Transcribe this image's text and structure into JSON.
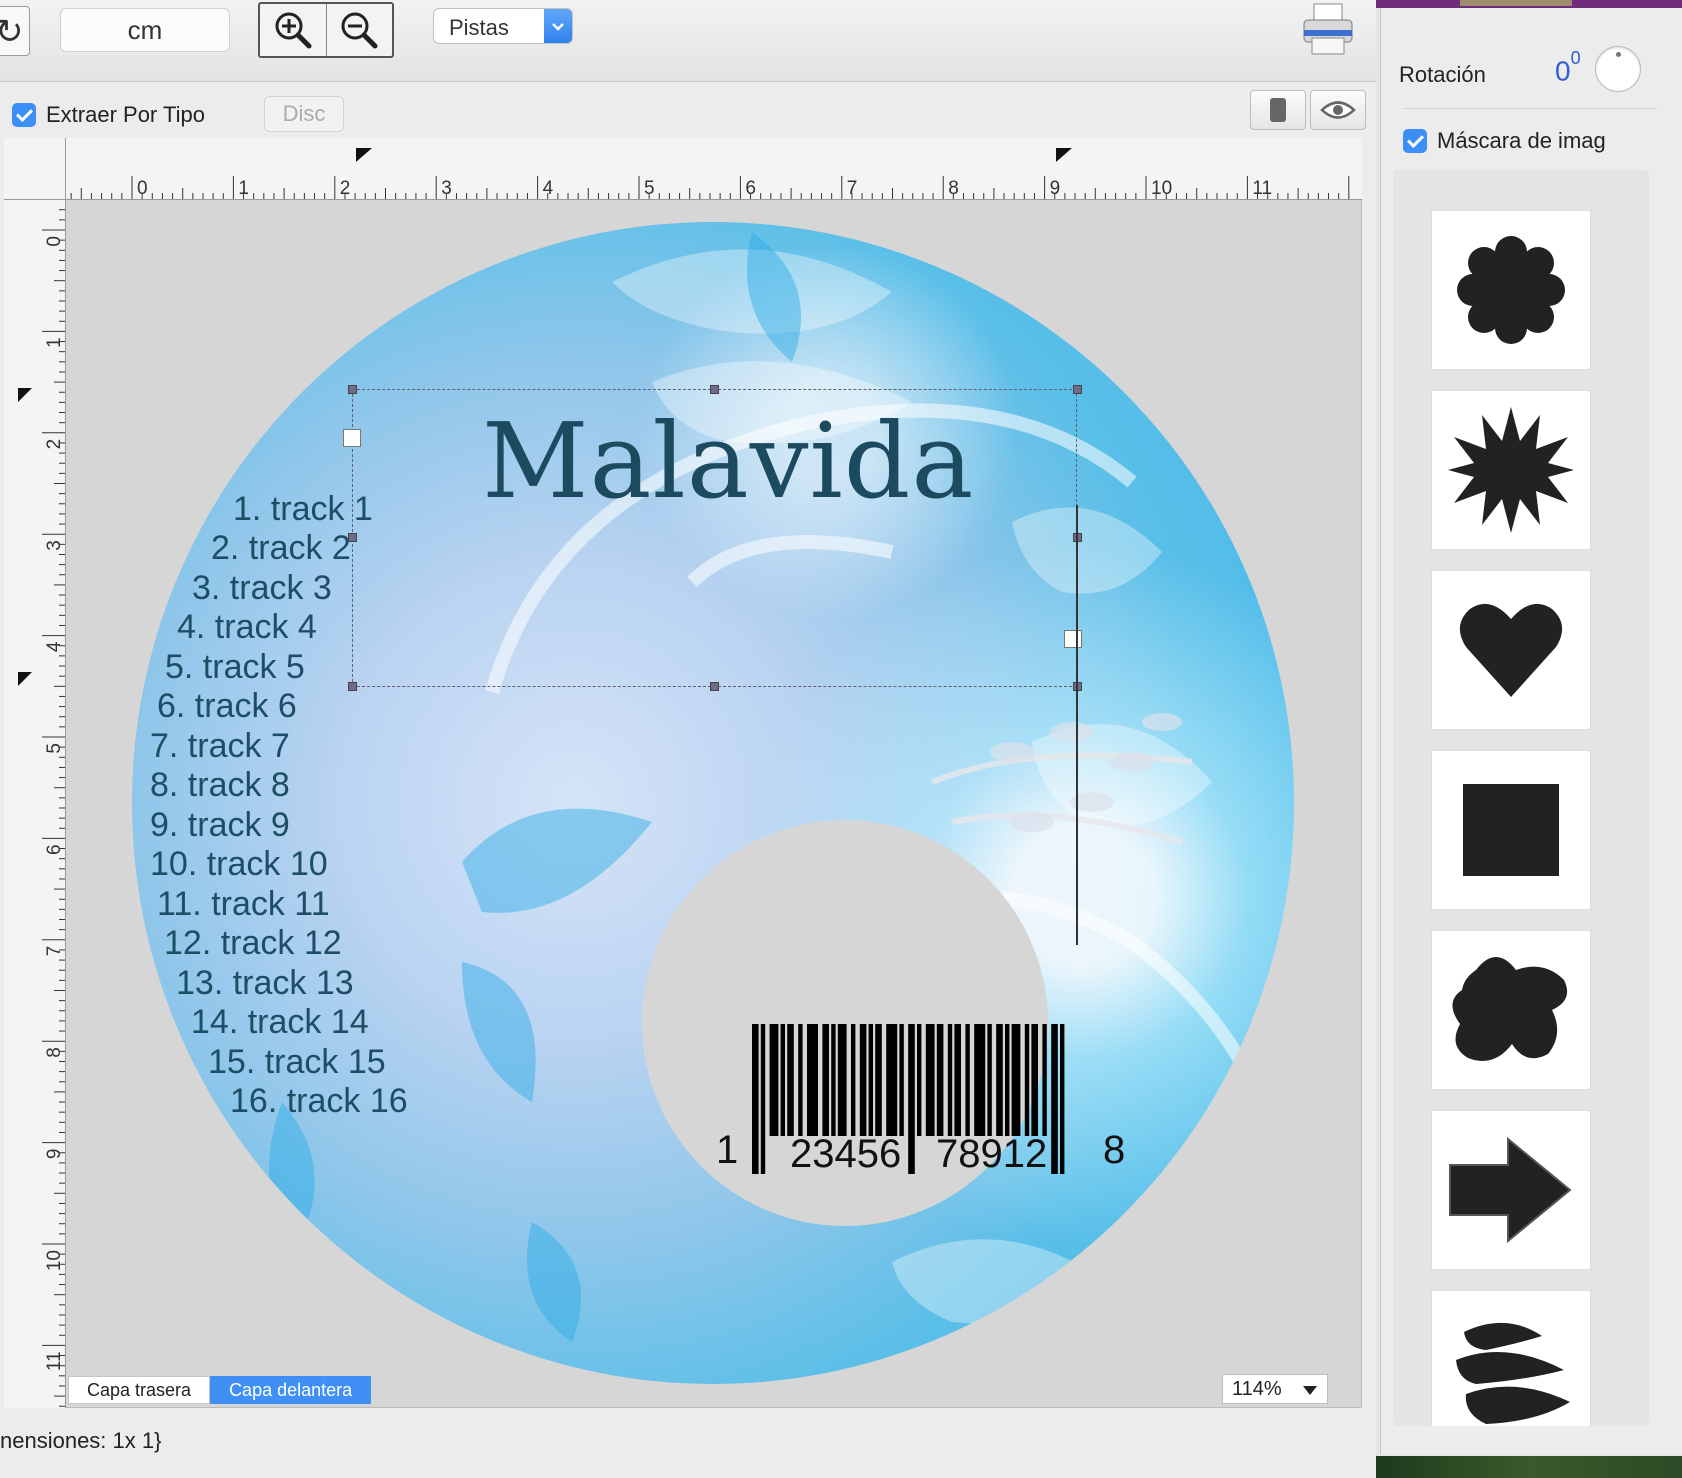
{
  "toolbar": {
    "unit_value": "cm",
    "track_select": "Pistas"
  },
  "options": {
    "extract_by_type_label": "Extraer Por Tipo",
    "extract_by_type_checked": true,
    "disc_button": "Disc"
  },
  "rulers": {
    "horizontal_labels": [
      "0",
      "1",
      "2",
      "3",
      "4",
      "5",
      "6",
      "7",
      "8",
      "9",
      "10",
      "11"
    ],
    "vertical_labels": [
      "0",
      "1",
      "2",
      "3",
      "4",
      "5",
      "6",
      "7",
      "8",
      "9",
      "10",
      "11"
    ]
  },
  "disc": {
    "title": "Malavida",
    "tracks": [
      "1.  track 1",
      "2. track 2",
      "3. track 3",
      "4. track 4",
      "5. track 5",
      "6. track 6",
      "7. track 7",
      "8. track 8",
      "9. track 9",
      "10. track 10",
      "11. track 11",
      "12. track 12",
      "13. track 13",
      "14. track 14",
      "15. track 15",
      "16. track 16"
    ],
    "barcode": {
      "first": "1",
      "left_group": "23456",
      "right_group": "78912",
      "last": "8"
    }
  },
  "layers": {
    "back": "Capa trasera",
    "front": "Capa delantera",
    "active": "front"
  },
  "zoom": {
    "value": "114%"
  },
  "status": {
    "text": "nensiones: 1x 1}"
  },
  "panel": {
    "rotation_label": "Rotación",
    "rotation_value": "0",
    "rotation_unit": "0",
    "mask_label": "Máscara de imag",
    "mask_checked": true,
    "shapes": [
      "flower-scalloped",
      "sunburst",
      "heart",
      "square",
      "blob",
      "arrow-right",
      "scribble"
    ]
  },
  "colors": {
    "accent": "#3f8ff5",
    "rotation_value": "#2f5fd6",
    "disc_text": "#1e4e66",
    "disc_title": "#1c4a5f"
  }
}
